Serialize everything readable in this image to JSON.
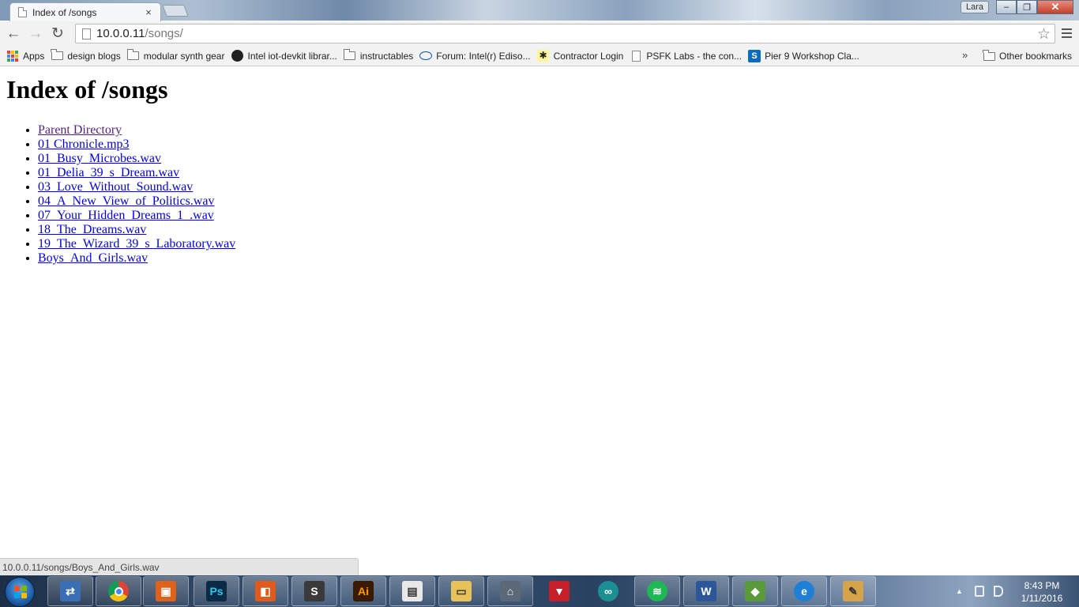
{
  "window": {
    "profile_name": "Lara",
    "minimize_label": "–",
    "maximize_label": "❐",
    "close_label": "✕"
  },
  "tab": {
    "title": "Index of /songs",
    "close_label": "×"
  },
  "toolbar": {
    "back_label": "←",
    "forward_label": "→",
    "reload_label": "↻",
    "url_host": "10.0.0.11",
    "url_path": "/songs/",
    "star_label": "☆"
  },
  "bookmarks": {
    "items": [
      {
        "label": "Apps",
        "icon": "apps-grid-icon"
      },
      {
        "label": "design blogs",
        "icon": "folder-icon"
      },
      {
        "label": "modular synth gear",
        "icon": "folder-icon"
      },
      {
        "label": "Intel iot-devkit librar...",
        "icon": "github-icon"
      },
      {
        "label": "instructables",
        "icon": "folder-icon"
      },
      {
        "label": "Forum: Intel(r) Ediso...",
        "icon": "intel-icon"
      },
      {
        "label": "Contractor Login",
        "icon": "contractor-icon"
      },
      {
        "label": "PSFK Labs - the con...",
        "icon": "page-icon"
      },
      {
        "label": "Pier 9 Workshop Cla...",
        "icon": "sharepoint-icon"
      }
    ],
    "overflow_label": "»",
    "other_label": "Other bookmarks"
  },
  "page": {
    "heading": "Index of /songs",
    "items": [
      {
        "label": "Parent Directory",
        "visited": true
      },
      {
        "label": "01 Chronicle.mp3",
        "visited": false
      },
      {
        "label": "01_Busy_Microbes.wav",
        "visited": false
      },
      {
        "label": "01_Delia_39_s_Dream.wav",
        "visited": false
      },
      {
        "label": "03_Love_Without_Sound.wav",
        "visited": false
      },
      {
        "label": "04_A_New_View_of_Politics.wav",
        "visited": false
      },
      {
        "label": "07_Your_Hidden_Dreams_1_.wav",
        "visited": false
      },
      {
        "label": "18_The_Dreams.wav",
        "visited": false
      },
      {
        "label": "19_The_Wizard_39_s_Laboratory.wav",
        "visited": false
      },
      {
        "label": "Boys_And_Girls.wav",
        "visited": false
      }
    ]
  },
  "status_url": "10.0.0.11/songs/Boys_And_Girls.wav",
  "taskbar": {
    "apps": [
      {
        "name": "remote-desktop-icon",
        "glyph": "⇄",
        "color": "#3b6fb5"
      },
      {
        "name": "chrome-icon",
        "glyph": "",
        "color": "#e0a020"
      },
      {
        "name": "slides-icon",
        "glyph": "▣",
        "color": "#e0621a"
      },
      {
        "name": "photoshop-icon",
        "glyph": "Ps",
        "color": "#0b2a44"
      },
      {
        "name": "office-icon",
        "glyph": "◧",
        "color": "#e05a1c"
      },
      {
        "name": "sublime-text-icon",
        "glyph": "S",
        "color": "#3a3a3a"
      },
      {
        "name": "illustrator-icon",
        "glyph": "Ai",
        "color": "#3a1a00"
      },
      {
        "name": "document-viewer-icon",
        "glyph": "▤",
        "color": "#e8e8e8"
      },
      {
        "name": "file-explorer-icon",
        "glyph": "▭",
        "color": "#e7c25a"
      },
      {
        "name": "network-icon",
        "glyph": "⌂",
        "color": "#5a6878"
      },
      {
        "name": "vector-app-icon",
        "glyph": "▼",
        "color": "#c81e2a"
      },
      {
        "name": "arduino-icon",
        "glyph": "∞",
        "color": "#1b8f93"
      },
      {
        "name": "spotify-icon",
        "glyph": "≋",
        "color": "#1db954"
      },
      {
        "name": "word-icon",
        "glyph": "W",
        "color": "#2b579a"
      },
      {
        "name": "avg-icon",
        "glyph": "◆",
        "color": "#5a9a3a"
      },
      {
        "name": "internet-explorer-icon",
        "glyph": "e",
        "color": "#1e7fd6"
      },
      {
        "name": "paint-icon",
        "glyph": "✎",
        "color": "#d6a24a"
      }
    ],
    "tray_arrow": "▲",
    "clock_time": "8:43 PM",
    "clock_date": "1/11/2016"
  }
}
